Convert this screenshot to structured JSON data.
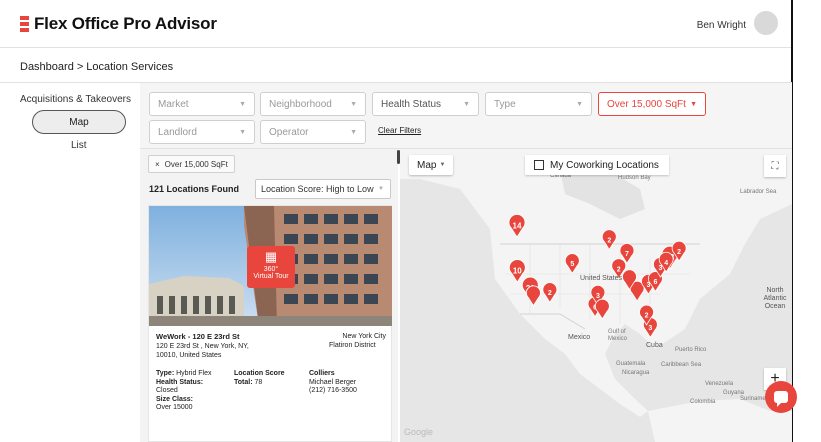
{
  "header": {
    "app_title": "Flex Office Pro Advisor",
    "user_name": "Ben Wright",
    "brand_color": "#e8453c"
  },
  "breadcrumb": {
    "root": "Dashboard",
    "separator": ">",
    "current": "Location Services"
  },
  "nav": {
    "section_title": "Acquisitions & Takeovers",
    "items": [
      {
        "label": "Map",
        "selected": true
      },
      {
        "label": "List",
        "selected": false
      }
    ]
  },
  "filters": {
    "market": "Market",
    "neighborhood": "Neighborhood",
    "health_status": "Health Status",
    "type": "Type",
    "size": "Over 15,000 SqFt",
    "landlord": "Landlord",
    "operator": "Operator",
    "clear": "Clear Filters"
  },
  "results": {
    "active_chip": "Over 15,000 SqFt",
    "count_label": "121 Locations Found",
    "sort": "Location Score: High to Low"
  },
  "listing": {
    "tour_line1": "360°",
    "tour_line2": "Virtual Tour",
    "name": "WeWork - 120 E 23rd St",
    "city": "New York City",
    "address": "120 E 23rd St , New York, NY, 10010, United States",
    "district": "Flatiron District",
    "type_label": "Type:",
    "type_value": "Hybrid Flex",
    "health_label": "Health Status:",
    "health_value": "Closed",
    "size_label": "Size Class:",
    "size_value": "Over 15000",
    "score_label": "Location Score",
    "score_total_label": "Total:",
    "score_total": "78",
    "broker_company": "Colliers",
    "broker_name": "Michael Berger",
    "broker_phone": "(212) 716-3500"
  },
  "map": {
    "type_select": "Map",
    "coworking_toggle": "My Coworking Locations",
    "labels": [
      "Canada",
      "Hudson Bay",
      "Labrador Sea",
      "United States",
      "North Atlantic Ocean",
      "Mexico",
      "Gulf of Mexico",
      "Cuba",
      "Puerto Rico",
      "Guatemala",
      "Nicaragua",
      "Caribbean Sea",
      "Venezuela",
      "Guyana",
      "Suriname",
      "Colombia"
    ],
    "pins": [
      {
        "label": "14",
        "lon": -122.4,
        "lat": 47.6
      },
      {
        "label": "10",
        "lon": -122.3,
        "lat": 37.8
      },
      {
        "label": "21",
        "lon": -118.2,
        "lat": 34.0
      },
      {
        "label": "2",
        "lon": -112.0,
        "lat": 33.4
      },
      {
        "label": "5",
        "lon": -104.9,
        "lat": 39.7
      },
      {
        "label": "2",
        "lon": -93.2,
        "lat": 44.9
      },
      {
        "label": "6",
        "lon": -97.7,
        "lat": 30.3
      },
      {
        "label": "3",
        "lon": -96.8,
        "lat": 32.8
      },
      {
        "label": "7",
        "lon": -87.6,
        "lat": 41.9
      },
      {
        "label": "2",
        "lon": -90.2,
        "lat": 38.6
      },
      {
        "label": "",
        "lon": -84.4,
        "lat": 33.7
      },
      {
        "label": "",
        "lon": -86.8,
        "lat": 36.2
      },
      {
        "label": "3",
        "lon": -80.8,
        "lat": 35.2
      },
      {
        "label": "6",
        "lon": -78.6,
        "lat": 35.8
      },
      {
        "label": "23",
        "lon": -74.0,
        "lat": 40.7
      },
      {
        "label": "2",
        "lon": -71.1,
        "lat": 42.4
      },
      {
        "label": "3",
        "lon": -77.0,
        "lat": 38.9
      },
      {
        "label": "4",
        "lon": -75.2,
        "lat": 40.0
      },
      {
        "label": "",
        "lon": -95.4,
        "lat": 29.8
      },
      {
        "label": "3",
        "lon": -80.2,
        "lat": 25.8
      },
      {
        "label": "2",
        "lon": -81.4,
        "lat": 28.5
      },
      {
        "label": "",
        "lon": -117.2,
        "lat": 32.7
      }
    ],
    "pin_color": "#e8453c"
  }
}
